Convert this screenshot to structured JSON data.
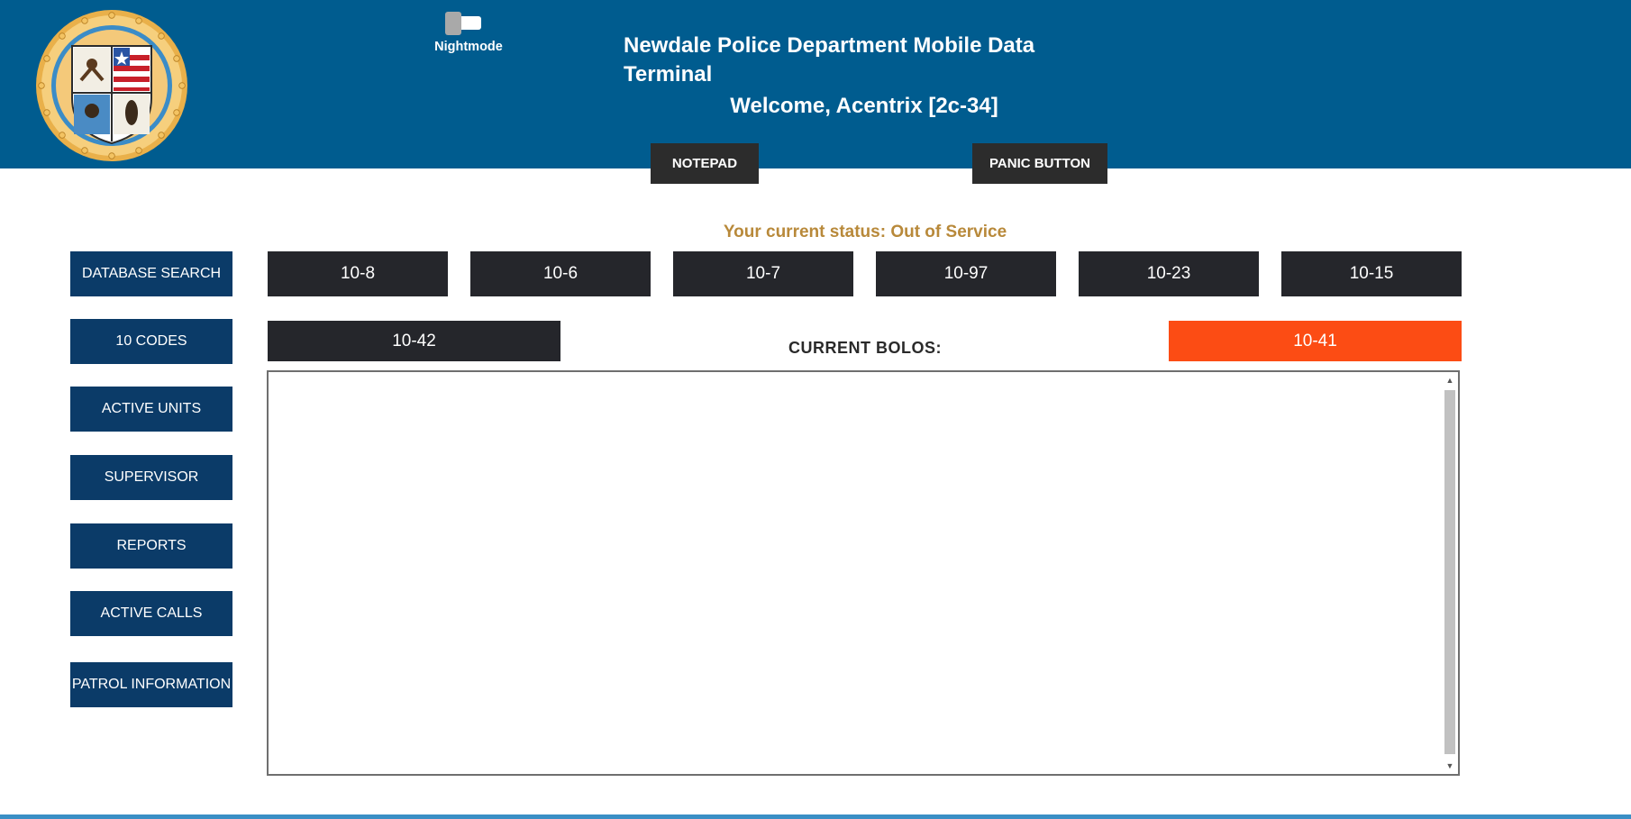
{
  "header": {
    "title": "Newdale Police Department  Mobile Data Terminal",
    "welcome": "Welcome, Acentrix [2c-34]",
    "nightmode_label": "Nightmode",
    "logo_icon": "police-seal-icon",
    "background_color": "#005c8f"
  },
  "top_buttons": {
    "notepad": "NOTEPAD",
    "panic": "PANIC BUTTON"
  },
  "status": {
    "text": "Your current status: Out of Service",
    "color": "#b8893a"
  },
  "sidebar": {
    "items": [
      {
        "label": "DATABASE SEARCH"
      },
      {
        "label": "10 CODES"
      },
      {
        "label": "ACTIVE UNITS"
      },
      {
        "label": "SUPERVISOR"
      },
      {
        "label": "REPORTS"
      },
      {
        "label": "ACTIVE CALLS"
      },
      {
        "label": "PATROL INFORMATION"
      }
    ],
    "color": "#0b3b68"
  },
  "codes": {
    "row1": [
      "10-8",
      "10-6",
      "10-7",
      "10-97",
      "10-23",
      "10-15"
    ],
    "row2_left": "10-42",
    "row2_right": "10-41",
    "alert_color": "#fc4c14"
  },
  "bolos": {
    "label": "CURRENT BOLOS:",
    "content": ""
  }
}
